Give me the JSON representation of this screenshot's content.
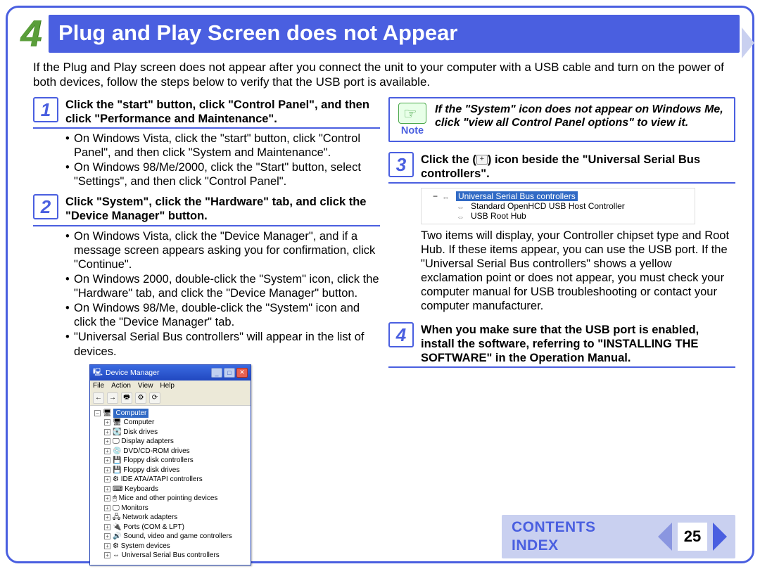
{
  "header": {
    "section_number": "4",
    "title": "Plug and Play Screen does not Appear"
  },
  "intro": "If the Plug and Play screen does not appear after you connect the unit to your computer with a USB cable and turn on the power of both devices, follow the steps below to verify that the USB port is available.",
  "note": {
    "label": "Note",
    "text": "If the \"System\" icon does not appear on Windows Me, click \"view all Control Panel options\" to view it."
  },
  "steps": [
    {
      "num": "1",
      "title": "Click the \"start\" button, click \"Control Panel\", and then click \"Performance and Maintenance\".",
      "bullets": [
        "On Windows Vista, click the \"start\" button, click \"Control Panel\", and then click \"System and Maintenance\".",
        "On Windows 98/Me/2000, click the \"Start\" button, select \"Settings\", and then click \"Control Panel\"."
      ]
    },
    {
      "num": "2",
      "title": "Click \"System\", click the \"Hardware\" tab, and click the \"Device Manager\" button.",
      "bullets": [
        "On Windows Vista, click the \"Device Manager\", and if a message screen appears asking you for confirmation, click \"Continue\".",
        "On Windows 2000, double-click the \"System\" icon, click the \"Hardware\" tab, and click the \"Device Manager\" button.",
        "On Windows 98/Me, double-click the \"System\" icon and click the \"Device Manager\" tab.",
        "\"Universal Serial Bus controllers\" will appear in the list of devices."
      ]
    },
    {
      "num": "3",
      "title_pre": "Click the (",
      "title_post": ") icon beside the \"Universal Serial Bus controllers\".",
      "desc": "Two items will display, your Controller chipset type and Root Hub. If these items appear, you can use the USB port. If the \"Universal Serial Bus controllers\" shows a yellow exclamation point or does not appear, you must check your computer manual for USB troubleshooting or contact your computer manufacturer."
    },
    {
      "num": "4",
      "title": "When you make sure that the USB port is enabled, install the software, referring to \"INSTALLING THE SOFTWARE\" in the Operation Manual."
    }
  ],
  "devmgr": {
    "title": "Device Manager",
    "menu": [
      "File",
      "Action",
      "View",
      "Help"
    ],
    "root": "Computer",
    "nodes": [
      "Computer",
      "Disk drives",
      "Display adapters",
      "DVD/CD-ROM drives",
      "Floppy disk controllers",
      "Floppy disk drives",
      "IDE ATA/ATAPI controllers",
      "Keyboards",
      "Mice and other pointing devices",
      "Monitors",
      "Network adapters",
      "Ports (COM & LPT)",
      "Sound, video and game controllers",
      "System devices",
      "Universal Serial Bus controllers"
    ]
  },
  "usb_tree": {
    "root": "Universal Serial Bus controllers",
    "children": [
      "Standard OpenHCD USB Host Controller",
      "USB Root Hub"
    ]
  },
  "footer": {
    "contents": "CONTENTS",
    "index": "INDEX",
    "page": "25"
  }
}
